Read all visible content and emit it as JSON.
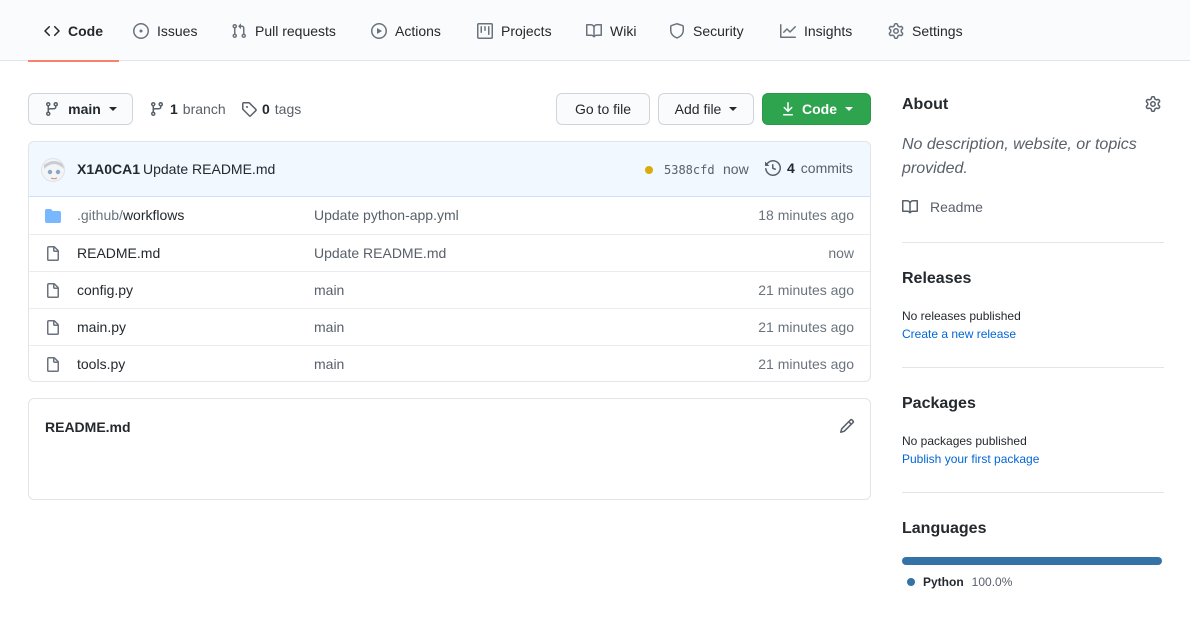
{
  "nav": {
    "tabs": [
      {
        "label": "Code",
        "icon": "code-icon",
        "active": true
      },
      {
        "label": "Issues",
        "icon": "issue-icon"
      },
      {
        "label": "Pull requests",
        "icon": "pull-request-icon"
      },
      {
        "label": "Actions",
        "icon": "play-icon"
      },
      {
        "label": "Projects",
        "icon": "project-icon"
      },
      {
        "label": "Wiki",
        "icon": "book-icon"
      },
      {
        "label": "Security",
        "icon": "shield-icon"
      },
      {
        "label": "Insights",
        "icon": "graph-icon"
      },
      {
        "label": "Settings",
        "icon": "gear-icon"
      }
    ]
  },
  "toolbar": {
    "branch_select": "main",
    "branch_count": "1",
    "branch_label": "branch",
    "tag_count": "0",
    "tag_label": "tags",
    "go_to_file": "Go to file",
    "add_file": "Add file",
    "code_button": "Code"
  },
  "commit": {
    "author": "X1A0CA1",
    "message": "Update README.md",
    "sha": "5388cfd",
    "time": "now",
    "count": "4",
    "count_label": "commits",
    "status_color": "#dbab09"
  },
  "files": [
    {
      "type": "folder",
      "name_dim": ".github/",
      "name": "workflows",
      "message": "Update python-app.yml",
      "time": "18 minutes ago"
    },
    {
      "type": "file",
      "name_dim": "",
      "name": "README.md",
      "message": "Update README.md",
      "time": "now"
    },
    {
      "type": "file",
      "name_dim": "",
      "name": "config.py",
      "message": "main",
      "time": "21 minutes ago"
    },
    {
      "type": "file",
      "name_dim": "",
      "name": "main.py",
      "message": "main",
      "time": "21 minutes ago"
    },
    {
      "type": "file",
      "name_dim": "",
      "name": "tools.py",
      "message": "main",
      "time": "21 minutes ago"
    }
  ],
  "readme_box": {
    "title": "README.md"
  },
  "sidebar": {
    "about": {
      "title": "About",
      "description": "No description, website, or topics provided.",
      "readme_link": "Readme"
    },
    "releases": {
      "title": "Releases",
      "empty_text": "No releases published",
      "link": "Create a new release"
    },
    "packages": {
      "title": "Packages",
      "empty_text": "No packages published",
      "link": "Publish your first package"
    },
    "languages": {
      "title": "Languages",
      "items": [
        {
          "name": "Python",
          "percent": "100.0%",
          "color": "#3572A5"
        }
      ]
    }
  },
  "colors": {
    "accent_underline": "#f9826c",
    "primary_button": "#2ea44f",
    "link": "#0366d6",
    "folder_icon": "#79b8ff"
  }
}
